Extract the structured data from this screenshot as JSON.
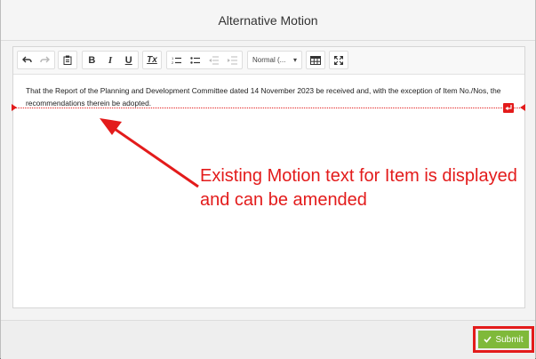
{
  "modal": {
    "title": "Alternative Motion"
  },
  "toolbar": {
    "undo_icon": "undo-icon",
    "redo_icon": "redo-icon",
    "paste_icon": "paste-icon",
    "bold_label": "B",
    "italic_label": "I",
    "underline_label": "U",
    "clear_format_label": "Tx",
    "format_select": "Normal (...",
    "table_icon": "table-icon",
    "maximize_icon": "maximize-icon"
  },
  "editor": {
    "content": "That the Report of the Planning and Development Committee dated 14 November 2023 be received and, with the exception of Item No./Nos, the recommendations therein be adopted."
  },
  "annotation": {
    "text": "Existing Motion text for Item is displayed and can be amended",
    "color": "#e31b1b"
  },
  "footer": {
    "submit_label": "Submit",
    "submit_color": "#7fb93a"
  }
}
